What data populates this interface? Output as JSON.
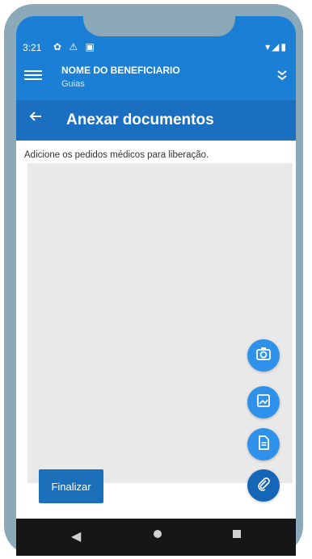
{
  "status_bar": {
    "time": "3:21",
    "left_icons": "✿ ⚠ ▣",
    "right_icons": "▾◢▮"
  },
  "header": {
    "beneficiary_name": "NOME DO BENEFICIARIO",
    "subtitle": "Guias"
  },
  "title_bar": {
    "title": "Anexar documentos"
  },
  "main": {
    "instruction": "Adicione os pedidos médicos para liberação."
  },
  "actions": {
    "finalize_label": "Finalizar",
    "fab_icons": [
      "camera-icon",
      "image-icon",
      "document-icon",
      "attach-icon"
    ]
  },
  "colors": {
    "header_blue": "#1c7fd6",
    "title_blue": "#1b6fc0",
    "fab_blue": "#2f91e9",
    "fab_dark": "#1666b8",
    "frame": "#8ba9b9"
  }
}
